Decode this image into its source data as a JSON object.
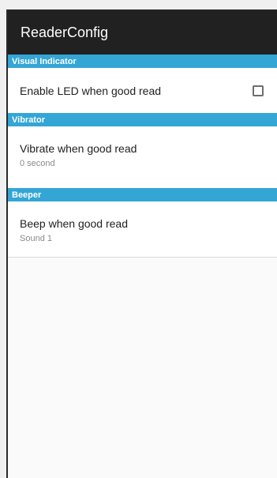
{
  "app_bar": {
    "title": "ReaderConfig"
  },
  "sections": [
    {
      "header": "Visual Indicator",
      "item": {
        "title": "Enable LED when good read",
        "checked": false
      }
    },
    {
      "header": "Vibrator",
      "item": {
        "title": "Vibrate when good read",
        "summary": "0 second"
      }
    },
    {
      "header": "Beeper",
      "item": {
        "title": "Beep when good read",
        "summary": "Sound 1"
      }
    }
  ],
  "colors": {
    "app_bar": "#212121",
    "section_header": "#33a6d6",
    "background": "#fafafa"
  }
}
